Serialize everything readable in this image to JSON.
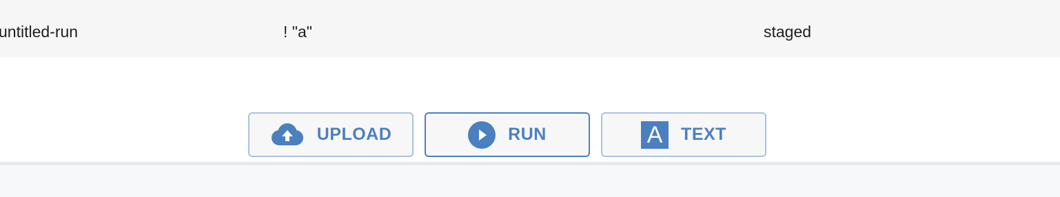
{
  "row": {
    "name": "untitled-run",
    "content": "! \"a\"",
    "status": "staged"
  },
  "actions": {
    "upload": {
      "label": "UPLOAD",
      "icon": "cloud-upload-icon"
    },
    "run": {
      "label": "RUN",
      "icon": "play-circle-icon",
      "active": true
    },
    "text": {
      "label": "TEXT",
      "icon": "letter-a-icon",
      "icon_glyph": "A"
    }
  },
  "colors": {
    "accent": "#4a80c0",
    "button_border": "#a9c2e0",
    "button_border_active": "#4a7fc0",
    "row_background": "#f6f6f6"
  }
}
